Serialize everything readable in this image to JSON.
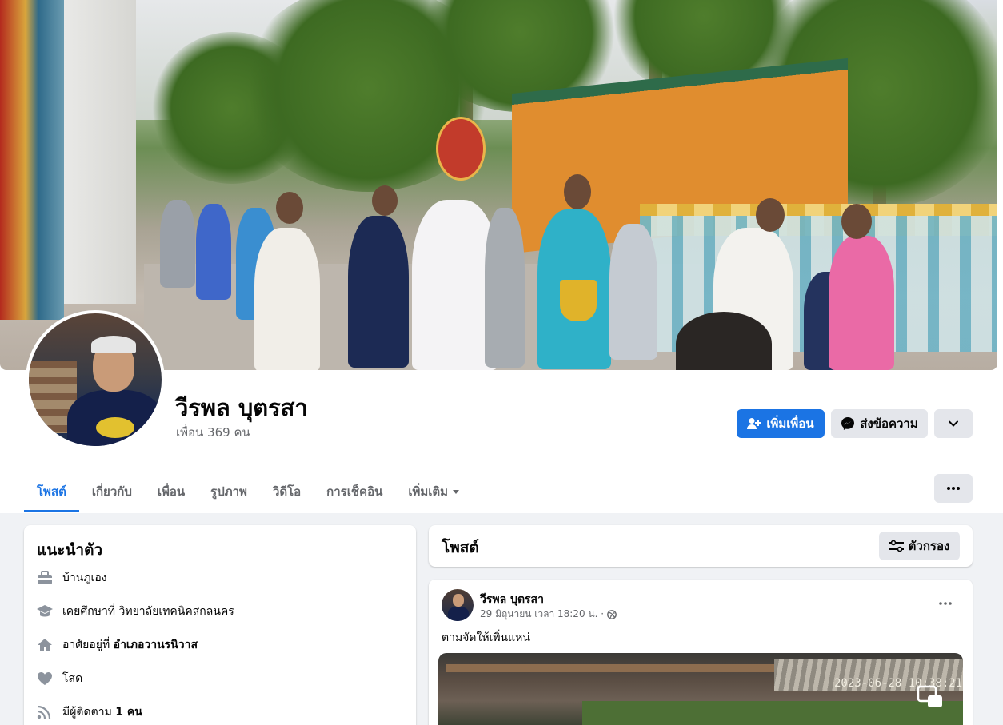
{
  "profile": {
    "name": "วีรพล บุตรสา",
    "friends_count": "เพื่อน 369 คน"
  },
  "actions": {
    "add_friend": "เพิ่มเพื่อน",
    "message": "ส่งข้อความ"
  },
  "tabs": [
    {
      "label": "โพสต์",
      "active": true
    },
    {
      "label": "เกี่ยวกับ"
    },
    {
      "label": "เพื่อน"
    },
    {
      "label": "รูปภาพ"
    },
    {
      "label": "วิดีโอ"
    },
    {
      "label": "การเช็คอิน"
    },
    {
      "label": "เพิ่มเติม"
    }
  ],
  "intro": {
    "title": "แนะนำตัว",
    "items": [
      {
        "icon": "briefcase-icon",
        "text": "บ้านภูเอง",
        "bold": ""
      },
      {
        "icon": "graduation-cap-icon",
        "text": "เคยศึกษาที่ วิทยาลัยเทคนิคสกลนคร",
        "bold": ""
      },
      {
        "icon": "home-icon",
        "text": "อาศัยอยู่ที่ ",
        "bold": "อำเภอวานรนิวาส"
      },
      {
        "icon": "heart-icon",
        "text": "โสด",
        "bold": ""
      },
      {
        "icon": "rss-icon",
        "text": "มีผู้ติดตาม ",
        "bold": "1 คน"
      }
    ]
  },
  "posts": {
    "title": "โพสต์",
    "filter_label": "ตัวกรอง",
    "post": {
      "author": "วีรพล บุตรสา",
      "timestamp": "29 มิถุนายน เวลา 18:20 น. ·",
      "text": "ตามจัดให้เพิ่นแหน่",
      "photo_stamp": "2023-06-28 10:38:21"
    }
  },
  "colors": {
    "accent": "#1b74e4",
    "background": "#f0f2f5",
    "secondary_button": "#e4e6eb",
    "muted_text": "#65676b"
  }
}
